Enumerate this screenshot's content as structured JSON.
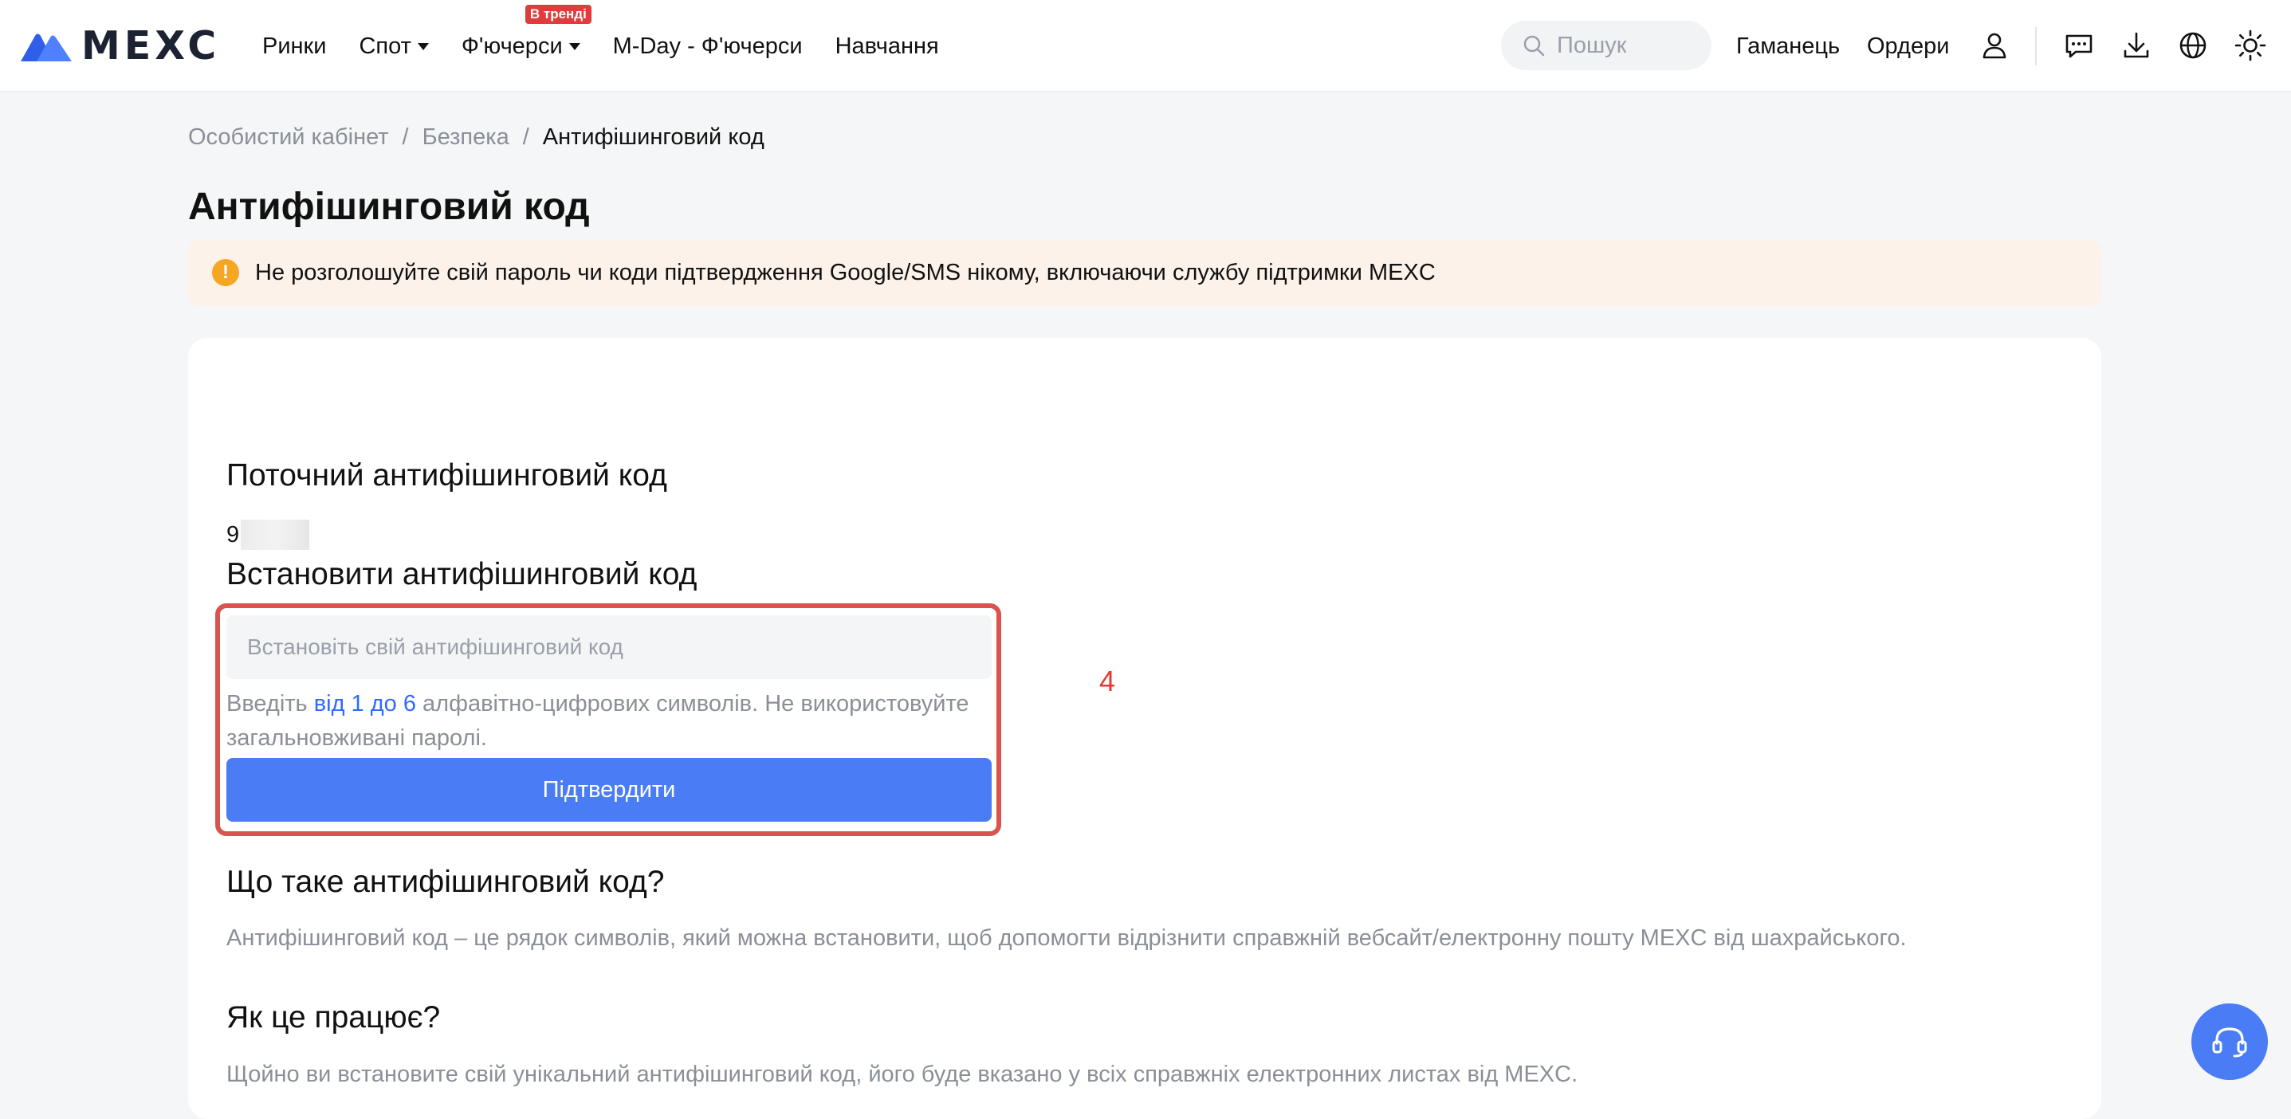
{
  "brand": {
    "name": "MEXC",
    "color": "#3d6ff5"
  },
  "nav": {
    "items": [
      {
        "label": "Ринки",
        "dropdown": false
      },
      {
        "label": "Спот",
        "dropdown": true
      },
      {
        "label": "Ф'ючерси",
        "dropdown": true,
        "badge": "В тренді"
      },
      {
        "label": "M-Day - Ф'ючерси",
        "dropdown": false
      },
      {
        "label": "Навчання",
        "dropdown": false
      }
    ],
    "search_placeholder": "Пошук",
    "wallet": "Гаманець",
    "orders": "Ордери",
    "icons": [
      "search-icon",
      "user-icon",
      "message-icon",
      "download-icon",
      "globe-icon",
      "theme-sun-icon"
    ]
  },
  "breadcrumb": {
    "items": [
      "Особистий кабінет",
      "Безпека"
    ],
    "current": "Антифішинговий код",
    "separator": "/"
  },
  "page": {
    "title": "Антифішинговий код",
    "alert": {
      "icon": "info-icon",
      "text": "Не розголошуйте свій пароль чи коди підтвердження Google/SMS нікому, включаючи службу підтримки MEXC",
      "bg_color": "#fcf2ea"
    }
  },
  "card": {
    "current_heading": "Поточний антифішинговий код",
    "current_value_visible": "9",
    "set_heading": "Встановити антифішинговий код",
    "input": {
      "placeholder": "Встановіть свій антифішинговий код",
      "value": ""
    },
    "hint": {
      "prefix": "Введіть ",
      "highlight": "від 1 до 6",
      "suffix": " алфавітно-цифрових символів. Не використовуйте загальновживані паролі."
    },
    "confirm_label": "Підтвердити",
    "annotation": {
      "number": "4",
      "color": "#d9534f"
    },
    "faq": [
      {
        "question": "Що таке антифішинговий код?",
        "answer": "Антифішинговий код – це рядок символів, який можна встановити, щоб допомогти відрізнити справжній вебсайт/електронну пошту MEXC від шахрайського."
      },
      {
        "question": "Як це працює?",
        "answer": "Щойно ви встановите свій унікальний антифішинговий код, його буде вказано у всіх справжніх електронних листах від MEXC."
      }
    ]
  },
  "colors": {
    "accent": "#4a7cf6",
    "link": "#2f6bff",
    "muted_text": "#8a8f98",
    "badge": "#e03c3c",
    "warning_icon": "#f5a623"
  },
  "support_icon": "support-headset-icon"
}
